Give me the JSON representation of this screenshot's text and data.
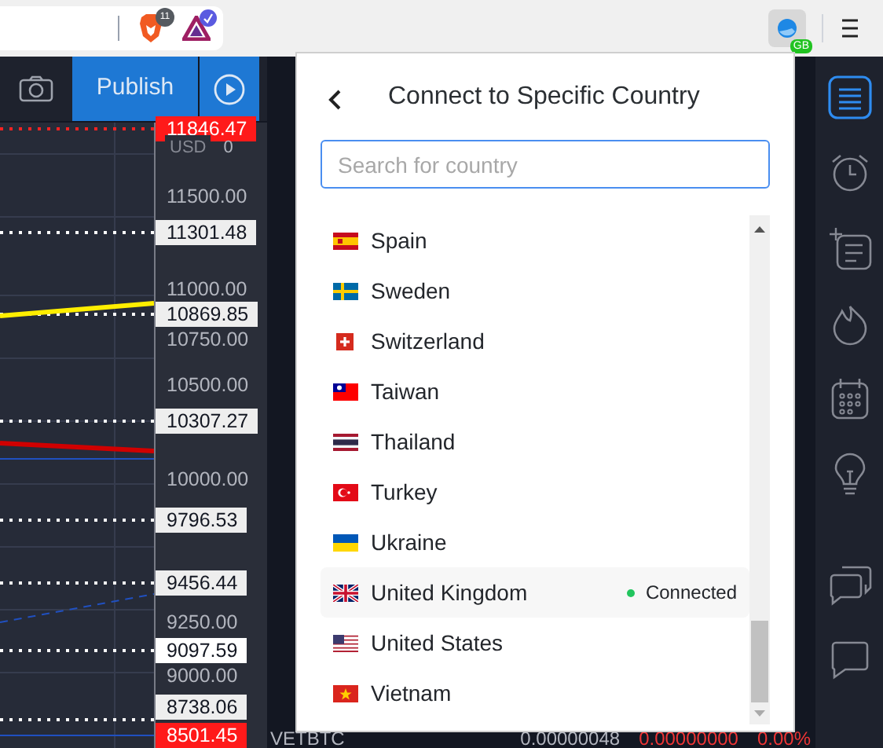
{
  "browser": {
    "brave_badge": "11",
    "extension_badge": "GB"
  },
  "toolbar": {
    "publish_label": "Publish"
  },
  "price_axis": {
    "currency": "USD",
    "currency_value": "0",
    "labels": [
      {
        "text": "11846.47",
        "kind": "alert"
      },
      {
        "text": "11500.00",
        "kind": "tick"
      },
      {
        "text": "11301.48",
        "kind": "marker"
      },
      {
        "text": "11000.00",
        "kind": "tick"
      },
      {
        "text": "10869.85",
        "kind": "marker"
      },
      {
        "text": "10750.00",
        "kind": "tick"
      },
      {
        "text": "10500.00",
        "kind": "tick"
      },
      {
        "text": "10307.27",
        "kind": "marker"
      },
      {
        "text": "10000.00",
        "kind": "tick"
      },
      {
        "text": "9796.53",
        "kind": "marker"
      },
      {
        "text": "9456.44",
        "kind": "marker"
      },
      {
        "text": "9250.00",
        "kind": "tick"
      },
      {
        "text": "9097.59",
        "kind": "highlight"
      },
      {
        "text": "9000.00",
        "kind": "tick"
      },
      {
        "text": "8738.06",
        "kind": "marker"
      },
      {
        "text": "8501.45",
        "kind": "alert"
      }
    ]
  },
  "popup": {
    "title": "Connect to Specific Country",
    "search": {
      "placeholder": "Search for country"
    },
    "countries": [
      {
        "name": "Spain",
        "connected": false
      },
      {
        "name": "Sweden",
        "connected": false
      },
      {
        "name": "Switzerland",
        "connected": false
      },
      {
        "name": "Taiwan",
        "connected": false
      },
      {
        "name": "Thailand",
        "connected": false
      },
      {
        "name": "Turkey",
        "connected": false
      },
      {
        "name": "Ukraine",
        "connected": false
      },
      {
        "name": "United Kingdom",
        "connected": true,
        "status": "Connected"
      },
      {
        "name": "United States",
        "connected": false
      },
      {
        "name": "Vietnam",
        "connected": false
      }
    ]
  },
  "watchlist_row": {
    "symbol": "VETBTC",
    "last": "0.00000048",
    "change": "0.00000000",
    "change_percent": "0.00%"
  }
}
